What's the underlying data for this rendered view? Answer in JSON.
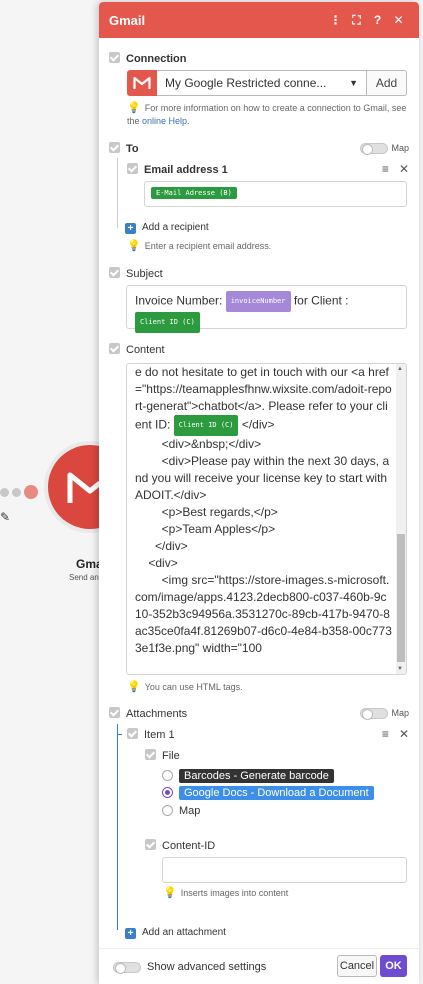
{
  "background": {
    "module_name": "Gmai",
    "module_sub": "Send an e"
  },
  "panel": {
    "title": "Gmail",
    "icons": [
      "more-vert-icon",
      "expand-icon",
      "help-icon",
      "close-icon"
    ],
    "icon_glyphs": [
      "⋮",
      "⛶",
      "?",
      "✕"
    ]
  },
  "connection": {
    "label": "Connection",
    "selected": "My Google Restricted conne...",
    "add_label": "Add",
    "hint_prefix": "For more information on how to create a connection to Gmail, see the ",
    "hint_link": "online Help",
    "hint_suffix": "."
  },
  "to": {
    "label": "To",
    "map_label": "Map",
    "item_label": "Email address 1",
    "email_pill": "E-Mail Adresse (B)",
    "add_recipient": "Add a recipient",
    "hint": "Enter a recipient email address."
  },
  "subject": {
    "label": "Subject",
    "prefix": "Invoice Number: ",
    "pill1": "invoiceNumber",
    "middle": " for Client :",
    "pill2": "Client ID (C)"
  },
  "content": {
    "label": "Content",
    "text_before": "e do not hesitate to get in touch with our <a href=\"https://teamapplesfhnw.wixsite.com/adoit-report-generat\">chatbot</a>. Please refer to your client ID: ",
    "pill": "Client ID (C)",
    "text_after": " </div>\n        <div>&nbsp;</div>\n        <div>Please pay within the next 30 days, and you will receive your license key to start with ADOIT.</div>\n        <p>Best regards,</p>\n        <p>Team Apples</p>\n      </div>\n    <div>\n        <img src=\"https://store-images.s-microsoft.com/image/apps.4123.2decb800-c037-460b-9c10-352b3c94956a.3531270c-89cb-417b-9470-8ac35ce0fa4f.81269b07-d6c0-4e84-b358-00c7733e1f3e.png\" width=\"100",
    "hint": "You can use HTML tags."
  },
  "attachments": {
    "label": "Attachments",
    "map_label": "Map",
    "item_label": "Item 1",
    "file_label": "File",
    "options": [
      "Barcodes - Generate barcode",
      "Google Docs - Download a Document",
      "Map"
    ],
    "selected_index": 1,
    "content_id_label": "Content-ID",
    "content_id_value": "",
    "content_id_hint": "Inserts images into content",
    "add_attachment": "Add an attachment"
  },
  "footer": {
    "advanced_label": "Show advanced settings",
    "cancel_label": "Cancel",
    "ok_label": "OK"
  }
}
